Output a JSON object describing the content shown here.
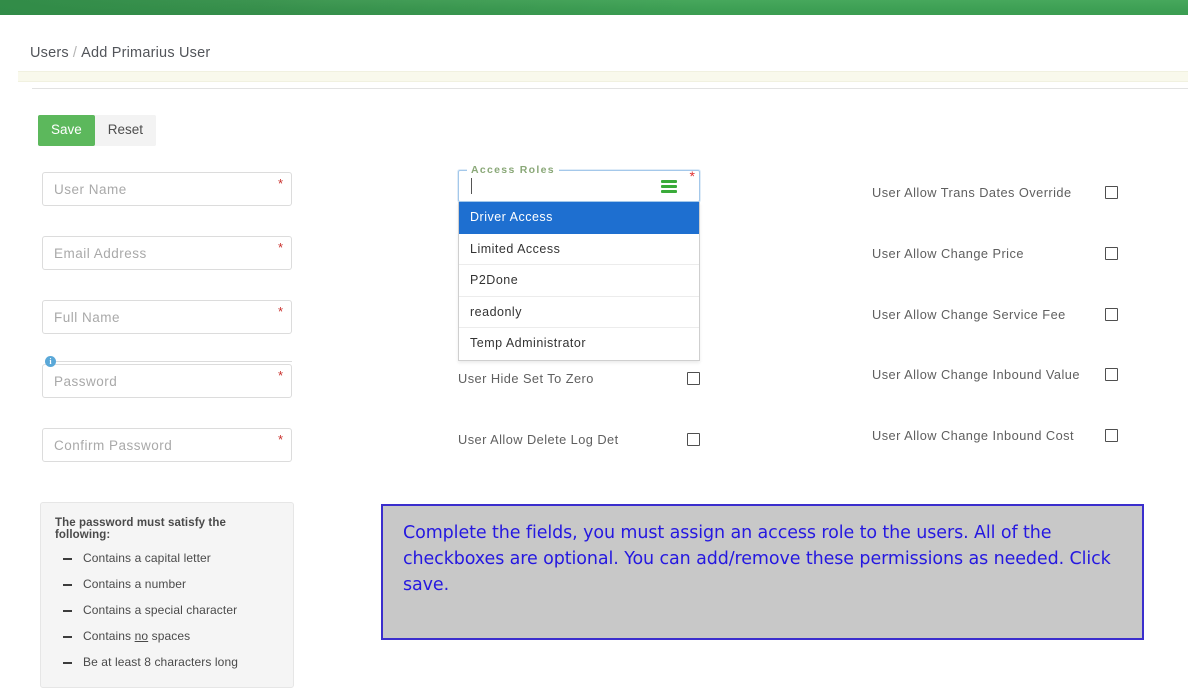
{
  "topbar": {
    "color": "#3ea055"
  },
  "breadcrumb": {
    "parent": "Users",
    "separator": "/",
    "current": "Add Primarius User"
  },
  "toolbar": {
    "save_label": "Save",
    "reset_label": "Reset"
  },
  "form": {
    "fields": [
      {
        "name": "user-name",
        "placeholder": "User Name",
        "value": "",
        "required_marker": "*"
      },
      {
        "name": "email-address",
        "placeholder": "Email Address",
        "value": "",
        "required_marker": "*"
      },
      {
        "name": "full-name",
        "placeholder": "Full Name",
        "value": "",
        "required_marker": "*"
      },
      {
        "name": "password",
        "placeholder": "Password",
        "value": "",
        "required_marker": "*",
        "info_glyph": "i"
      },
      {
        "name": "confirm-password",
        "placeholder": "Confirm Password",
        "value": "",
        "required_marker": "*"
      }
    ]
  },
  "password_rules": {
    "title": "The password must satisfy the following:",
    "items": [
      "Contains a capital letter",
      "Contains a number",
      "Contains a special character",
      "Contains no spaces",
      "Be at least 8 characters long"
    ],
    "underlined_word": "no"
  },
  "access_roles": {
    "legend": "Access Roles",
    "value": "",
    "required_marker": "*",
    "menu_icon": "hamburger-menu-icon",
    "highlight_color": "#1e6fd0",
    "options": [
      "Driver Access",
      "Limited Access",
      "P2Done",
      "readonly",
      "Temp Administrator"
    ],
    "selected_index": 0
  },
  "permissions": {
    "middle_column": [
      {
        "label": "User Hide Set To Zero",
        "checked": false
      },
      {
        "label": "User Allow Delete Log Det",
        "checked": false
      }
    ],
    "right_column": [
      {
        "label": "User Allow Trans Dates Override",
        "checked": false
      },
      {
        "label": "User Allow Change Price",
        "checked": false
      },
      {
        "label": "User Allow Change Service Fee",
        "checked": false
      },
      {
        "label": "User Allow Change Inbound Value",
        "checked": false
      },
      {
        "label": "User Allow Change Inbound Cost",
        "checked": false
      }
    ]
  },
  "callout": {
    "text": "Complete the fields, you must assign an access role to the users.  All of the checkboxes are optional.  You can add/remove these permissions as needed.  Click save.",
    "border_color": "#3b2ecd",
    "background_color": "#c8c8c8",
    "text_color": "#2518e0"
  }
}
